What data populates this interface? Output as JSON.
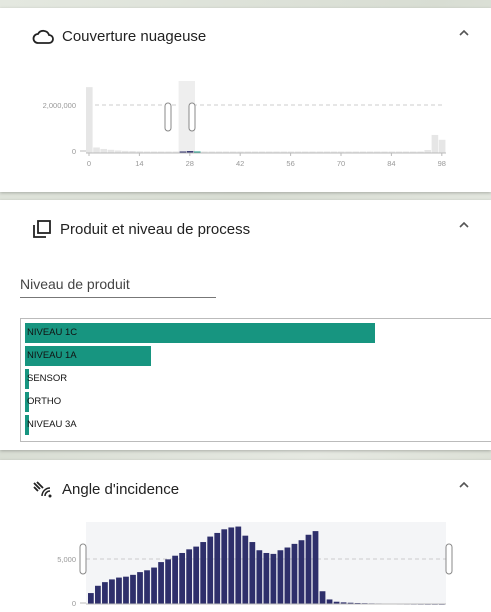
{
  "cloud": {
    "title": "Couverture nuageuse",
    "y_ticks": [
      "2,000,000",
      "0"
    ],
    "x_ticks": [
      "0",
      "14",
      "28",
      "42",
      "56",
      "70",
      "84",
      "98"
    ]
  },
  "product": {
    "title": "Produit et niveau de process",
    "field_label": "Niveau de produit",
    "items": [
      {
        "label": "NIVEAU 1C",
        "fraction": 1.0
      },
      {
        "label": "NIVEAU 1A",
        "fraction": 0.36
      },
      {
        "label": "SENSOR",
        "fraction": 0.012
      },
      {
        "label": "ORTHO",
        "fraction": 0.012
      },
      {
        "label": "NIVEAU 3A",
        "fraction": 0.012
      }
    ]
  },
  "incidence": {
    "title": "Angle d'incidence",
    "y_ticks": [
      "5,000",
      "0"
    ]
  },
  "colors": {
    "accent": "#179580",
    "bar_dark": "#2e2f6b",
    "bar_light": "#e6e6e6"
  },
  "chart_data": [
    {
      "type": "bar",
      "title": "Couverture nuageuse",
      "xlabel": "",
      "ylabel": "",
      "xlim": [
        0,
        100
      ],
      "ylim": [
        0,
        3200000
      ],
      "x": [
        0,
        2,
        4,
        6,
        8,
        10,
        12,
        14,
        16,
        18,
        20,
        22,
        24,
        26,
        28,
        30,
        32,
        34,
        36,
        38,
        40,
        42,
        44,
        46,
        48,
        50,
        52,
        54,
        56,
        58,
        60,
        62,
        64,
        66,
        68,
        70,
        72,
        74,
        76,
        78,
        80,
        82,
        84,
        86,
        88,
        90,
        92,
        94,
        96,
        98
      ],
      "values": [
        3100000,
        260000,
        190000,
        150000,
        120000,
        100000,
        90000,
        80000,
        70000,
        65000,
        60000,
        55000,
        55000,
        70000,
        90000,
        50000,
        45000,
        40000,
        38000,
        36000,
        34000,
        32000,
        30000,
        30000,
        28000,
        28000,
        27000,
        26000,
        26000,
        25000,
        25000,
        24000,
        24000,
        24000,
        23000,
        23000,
        23000,
        24000,
        25000,
        26000,
        28000,
        30000,
        35000,
        40000,
        50000,
        60000,
        70000,
        140000,
        850000,
        620000
      ],
      "selected_range": [
        26,
        30
      ]
    },
    {
      "type": "bar",
      "title": "Angle d'incidence",
      "xlabel": "",
      "ylabel": "",
      "ylim": [
        0,
        9000
      ],
      "values": [
        1200,
        2000,
        2400,
        2700,
        2900,
        3000,
        3200,
        3500,
        3700,
        4000,
        4600,
        4900,
        5300,
        5600,
        6000,
        6300,
        6800,
        7400,
        7800,
        8200,
        8400,
        8500,
        7500,
        6800,
        5900,
        5600,
        5500,
        5900,
        6200,
        6600,
        7000,
        7600,
        8000,
        1400,
        500,
        250,
        180,
        140,
        110,
        90,
        70,
        60,
        50,
        40,
        30,
        25,
        20,
        15,
        10,
        8,
        5
      ],
      "selected_range": [
        0,
        1
      ]
    }
  ]
}
